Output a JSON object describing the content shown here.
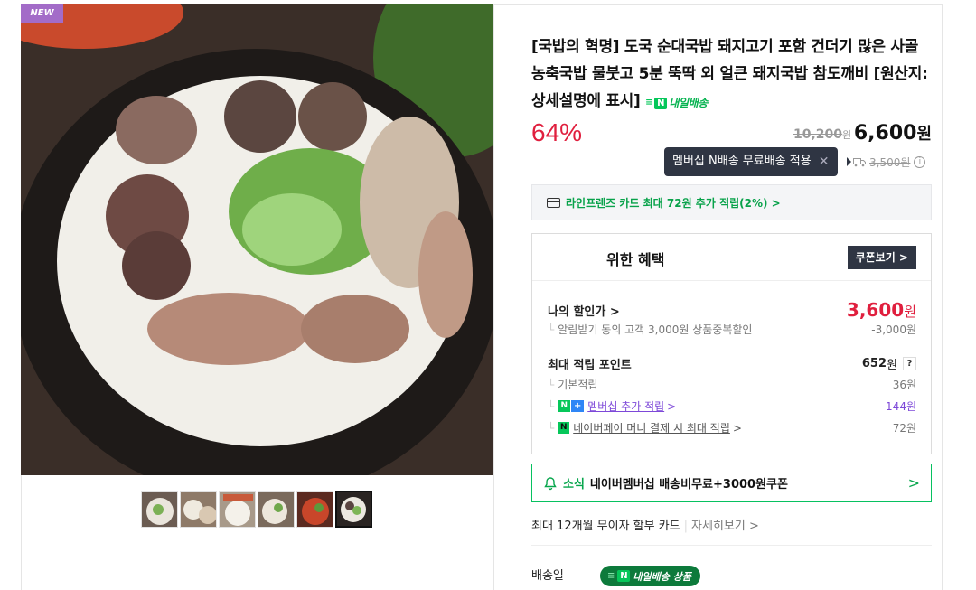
{
  "gallery": {
    "badge": "NEW",
    "thumbnail_count": 6,
    "selected_index": 5
  },
  "product": {
    "title": "[국밥의 혁명] 도국 순대국밥 돼지고기 포함 건더기 많은 사골 농축국밥 물붓고 5분 뚝딱 외 얼큰 돼지국밥 참도깨비 [원산지:상세설명에 표시]",
    "delivery_tag": "내일배송",
    "discount": "64%",
    "original_price": "10,200",
    "original_price_unit": "원",
    "sale_price": "6,600",
    "sale_price_unit": "원"
  },
  "tooltip": {
    "text": "멤버십 N배송 무료배송 적용",
    "close": "✕"
  },
  "shipping_fee": {
    "amount": "3,500원"
  },
  "card_banner": {
    "text": "라인프렌즈 카드 최대 72원 추가 적립(2%) >"
  },
  "benefits": {
    "title": "위한 혜택",
    "coupon_button": "쿠폰보기 >",
    "my_price_label": "나의 할인가 >",
    "my_price": "3,600",
    "my_price_unit": "원",
    "alarm_label": "알림받기 동의 고객 3,000원 상품중복할인",
    "alarm_value": "-3,000원",
    "max_points_label": "최대 적립 포인트",
    "max_points_value": "652",
    "max_points_unit": "원",
    "help": "?",
    "basic_label": "기본적립",
    "basic_value": "36원",
    "membership_badge_n": "N",
    "membership_badge_plus": "+",
    "membership_label": "멤버십 추가 적립",
    "membership_arrow": ">",
    "membership_value": "144원",
    "npay_badge": "N",
    "npay_label": "네이버페이 머니 결제 시 최대 적립",
    "npay_arrow": ">",
    "npay_value": "72원"
  },
  "news": {
    "tag": "소식",
    "text": "네이버멤버십 배송비무료+3000원쿠폰",
    "chevron": ">"
  },
  "installment": {
    "text": "최대 12개월 무이자 할부 카드",
    "more": "자세히보기 >"
  },
  "shipping": {
    "label": "배송일",
    "pill": "내일배송 상품"
  },
  "colors": {
    "discount_red": "#e01f3e",
    "naver_green": "#06c75a",
    "membership_purple": "#7d48d8",
    "tooltip_dark": "#2f3543",
    "new_badge_purple": "#a36cc8"
  }
}
